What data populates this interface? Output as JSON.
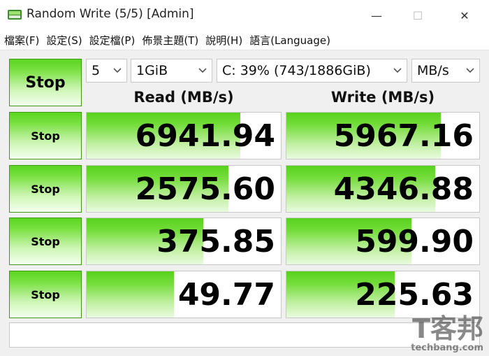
{
  "window": {
    "title": "Random Write (5/5) [Admin]",
    "minimize_glyph": "—",
    "maximize_glyph": "☐",
    "close_glyph": "✕"
  },
  "menu": [
    "檔案(F)",
    "設定(S)",
    "設定檔(P)",
    "佈景主題(T)",
    "說明(H)",
    "語言(Language)"
  ],
  "controls": {
    "main_button": "Stop",
    "count": "5",
    "size": "1GiB",
    "drive": "C: 39% (743/1886GiB)",
    "unit": "MB/s"
  },
  "headers": {
    "read": "Read (MB/s)",
    "write": "Write (MB/s)"
  },
  "rows": [
    {
      "button": "Stop",
      "read": "6941.94",
      "write": "5967.16",
      "read_fill": 0.79,
      "write_fill": 0.8
    },
    {
      "button": "Stop",
      "read": "2575.60",
      "write": "4346.88",
      "read_fill": 0.73,
      "write_fill": 0.77
    },
    {
      "button": "Stop",
      "read": "375.85",
      "write": "599.90",
      "read_fill": 0.6,
      "write_fill": 0.65
    },
    {
      "button": "Stop",
      "read": "49.77",
      "write": "225.63",
      "read_fill": 0.45,
      "write_fill": 0.56
    }
  ],
  "status": "",
  "watermark": {
    "mark": "T客邦",
    "site": "techbang.com"
  },
  "colors": {
    "accent_green": "#58d11d",
    "border": "#c8c8c8"
  }
}
